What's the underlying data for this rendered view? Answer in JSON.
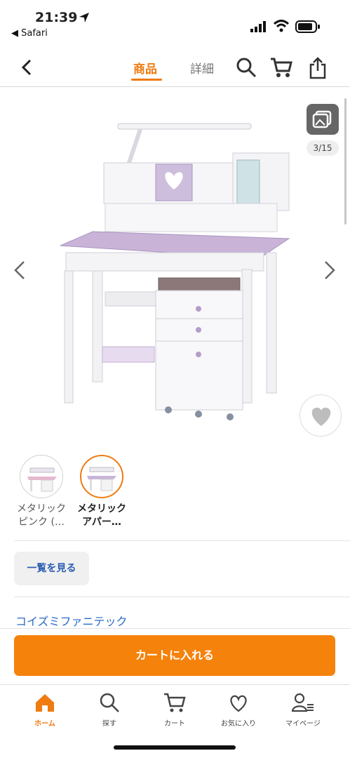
{
  "status": {
    "time": "21:39",
    "back_app": "◀ Safari"
  },
  "header": {
    "tab_product": "商品",
    "tab_detail": "詳細"
  },
  "gallery": {
    "counter": "3/15"
  },
  "variants": [
    {
      "label_line1": "メタリック",
      "label_line2": "ピンク (…"
    },
    {
      "label_line1": "メタリック",
      "label_line2": "アパー…"
    }
  ],
  "list_button": "一覧を見る",
  "brand": "コイズミファニテック",
  "cart_button": "カートに入れる",
  "tabbar": [
    {
      "label": "ホーム",
      "icon": "home-icon"
    },
    {
      "label": "探す",
      "icon": "search-icon"
    },
    {
      "label": "カート",
      "icon": "cart-icon"
    },
    {
      "label": "お気に入り",
      "icon": "heart-icon"
    },
    {
      "label": "マイページ",
      "icon": "user-icon"
    }
  ],
  "colors": {
    "accent": "#ef7b11",
    "button": "#f5820b",
    "link": "#2a6bc6"
  }
}
